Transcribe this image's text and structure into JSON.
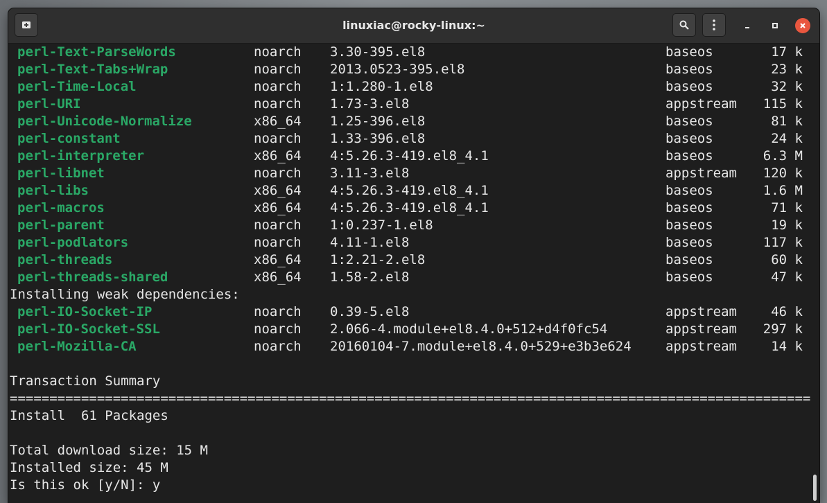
{
  "window": {
    "title": "linuxiac@rocky-linux:~"
  },
  "icons": {
    "new_tab": "new-tab-icon",
    "search": "search-icon",
    "menu": "kebab-menu-icon",
    "minimize": "minimize-icon",
    "maximize": "maximize-icon",
    "close": "close-icon"
  },
  "colors": {
    "package_name": "#2aa866",
    "background": "#1e1e1e",
    "text": "#e6e6e6",
    "close": "#e9573f"
  },
  "packages": [
    {
      "name": "perl-Text-ParseWords",
      "arch": "noarch",
      "version": "3.30-395.el8",
      "repo": "baseos",
      "size": "17 k"
    },
    {
      "name": "perl-Text-Tabs+Wrap",
      "arch": "noarch",
      "version": "2013.0523-395.el8",
      "repo": "baseos",
      "size": "23 k"
    },
    {
      "name": "perl-Time-Local",
      "arch": "noarch",
      "version": "1:1.280-1.el8",
      "repo": "baseos",
      "size": "32 k"
    },
    {
      "name": "perl-URI",
      "arch": "noarch",
      "version": "1.73-3.el8",
      "repo": "appstream",
      "size": "115 k"
    },
    {
      "name": "perl-Unicode-Normalize",
      "arch": "x86_64",
      "version": "1.25-396.el8",
      "repo": "baseos",
      "size": "81 k"
    },
    {
      "name": "perl-constant",
      "arch": "noarch",
      "version": "1.33-396.el8",
      "repo": "baseos",
      "size": "24 k"
    },
    {
      "name": "perl-interpreter",
      "arch": "x86_64",
      "version": "4:5.26.3-419.el8_4.1",
      "repo": "baseos",
      "size": "6.3 M"
    },
    {
      "name": "perl-libnet",
      "arch": "noarch",
      "version": "3.11-3.el8",
      "repo": "appstream",
      "size": "120 k"
    },
    {
      "name": "perl-libs",
      "arch": "x86_64",
      "version": "4:5.26.3-419.el8_4.1",
      "repo": "baseos",
      "size": "1.6 M"
    },
    {
      "name": "perl-macros",
      "arch": "x86_64",
      "version": "4:5.26.3-419.el8_4.1",
      "repo": "baseos",
      "size": "71 k"
    },
    {
      "name": "perl-parent",
      "arch": "noarch",
      "version": "1:0.237-1.el8",
      "repo": "baseos",
      "size": "19 k"
    },
    {
      "name": "perl-podlators",
      "arch": "noarch",
      "version": "4.11-1.el8",
      "repo": "baseos",
      "size": "117 k"
    },
    {
      "name": "perl-threads",
      "arch": "x86_64",
      "version": "1:2.21-2.el8",
      "repo": "baseos",
      "size": "60 k"
    },
    {
      "name": "perl-threads-shared",
      "arch": "x86_64",
      "version": "1.58-2.el8",
      "repo": "baseos",
      "size": "47 k"
    }
  ],
  "weak_header": "Installing weak dependencies:",
  "weak_packages": [
    {
      "name": "perl-IO-Socket-IP",
      "arch": "noarch",
      "version": "0.39-5.el8",
      "repo": "appstream",
      "size": "46 k"
    },
    {
      "name": "perl-IO-Socket-SSL",
      "arch": "noarch",
      "version": "2.066-4.module+el8.4.0+512+d4f0fc54",
      "repo": "appstream",
      "size": "297 k"
    },
    {
      "name": "perl-Mozilla-CA",
      "arch": "noarch",
      "version": "20160104-7.module+el8.4.0+529+e3b3e624",
      "repo": "appstream",
      "size": "14 k"
    }
  ],
  "summary": {
    "title": "Transaction Summary",
    "separator": "==================================================================================================================================================================================",
    "install": "Install  61 Packages",
    "download_size": "Total download size: 15 M",
    "installed_size": "Installed size: 45 M",
    "prompt": "Is this ok [y/N]: y"
  }
}
